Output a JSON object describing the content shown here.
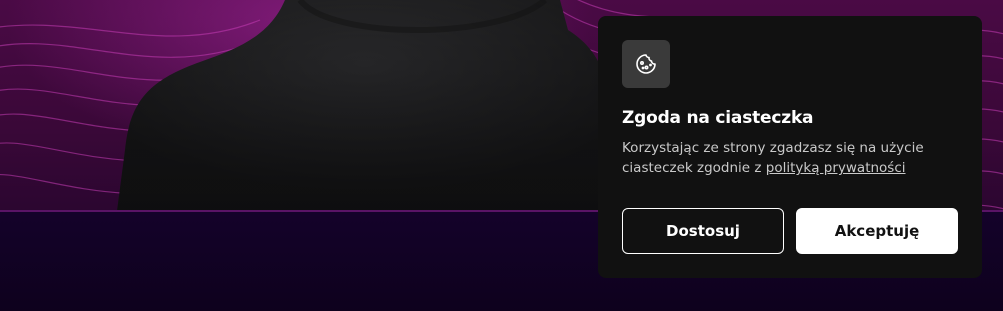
{
  "cookie_dialog": {
    "icon": "cookie-icon",
    "title": "Zgoda na ciasteczka",
    "text_before_link": "Korzystając ze strony zgadzasz się na użycie ciasteczek zgodnie z ",
    "link_label": "polityką prywatności",
    "customize_label": "Dostosuj",
    "accept_label": "Akceptuję"
  },
  "colors": {
    "card_background": "#111111",
    "hero_accent": "#a0288f",
    "page_background": "#12021f"
  }
}
